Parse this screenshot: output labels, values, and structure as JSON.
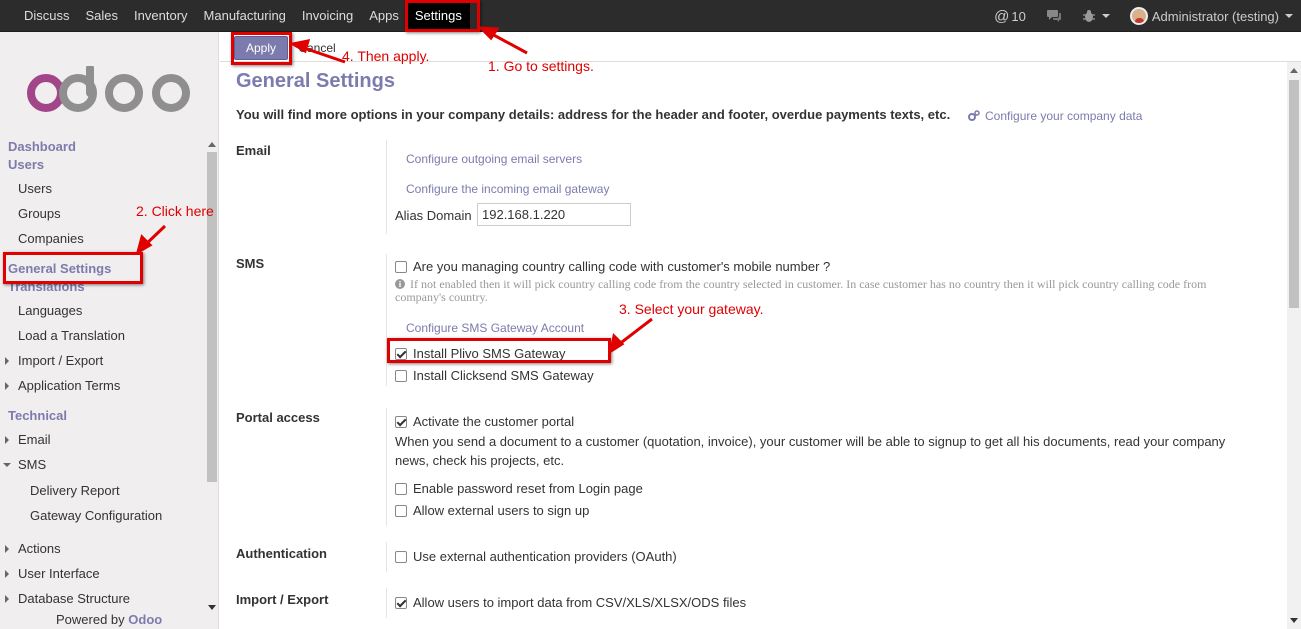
{
  "topbar": {
    "menu": [
      "Discuss",
      "Sales",
      "Inventory",
      "Manufacturing",
      "Invoicing",
      "Apps",
      "Settings"
    ],
    "active": "Settings",
    "mention_count": "10",
    "user": "Administrator (testing)"
  },
  "sidebar": {
    "dashboard": "Dashboard",
    "users_section": "Users",
    "users": "Users",
    "groups": "Groups",
    "companies": "Companies",
    "general_settings": "General Settings",
    "translations_section": "Translations",
    "languages": "Languages",
    "load_translation": "Load a Translation",
    "import_export": "Import / Export",
    "application_terms": "Application Terms",
    "technical_section": "Technical",
    "email": "Email",
    "sms": "SMS",
    "delivery_report": "Delivery Report",
    "gateway_configuration": "Gateway Configuration",
    "actions": "Actions",
    "user_interface": "User Interface",
    "database_structure": "Database Structure",
    "powered_by": "Powered by",
    "powered_brand": "Odoo"
  },
  "control": {
    "apply": "Apply",
    "cancel": "Cancel"
  },
  "page": {
    "title": "General Settings",
    "intro": "You will find more options in your company details: address for the header and footer, overdue payments texts, etc.",
    "configure_company": "Configure your company data"
  },
  "email": {
    "label": "Email",
    "outgoing": "Configure outgoing email servers",
    "incoming": "Configure the incoming email gateway",
    "alias_label": "Alias Domain",
    "alias_value": "192.168.1.220"
  },
  "sms": {
    "label": "SMS",
    "country_code_q": "Are you managing country calling code with customer's mobile number ?",
    "country_code_hint": "If not enabled then it will pick country calling code from the country selected in customer. In case customer has no country then it will pick country calling code from company's country.",
    "configure_gateway": "Configure SMS Gateway Account",
    "plivo": "Install Plivo SMS Gateway",
    "plivo_checked": true,
    "clicksend": "Install Clicksend SMS Gateway",
    "clicksend_checked": false
  },
  "portal": {
    "label": "Portal access",
    "activate": "Activate the customer portal",
    "description": "When you send a document to a customer (quotation, invoice), your customer will be able to signup to get all his documents, read your company news, check his projects, etc.",
    "password_reset": "Enable password reset from Login page",
    "external_signup": "Allow external users to sign up"
  },
  "auth": {
    "label": "Authentication",
    "oauth": "Use external authentication providers (OAuth)"
  },
  "import_export": {
    "label": "Import / Export",
    "allow_import": "Allow users to import data from CSV/XLS/XLSX/ODS files"
  },
  "annotations": {
    "step1": "1. Go to settings.",
    "step2": "2. Click here",
    "step3": "3. Select your gateway.",
    "step4": "4. Then apply.",
    "color": "#e00000"
  },
  "colors": {
    "brand": "#7c7bad",
    "topbar": "#2c2c2c"
  }
}
